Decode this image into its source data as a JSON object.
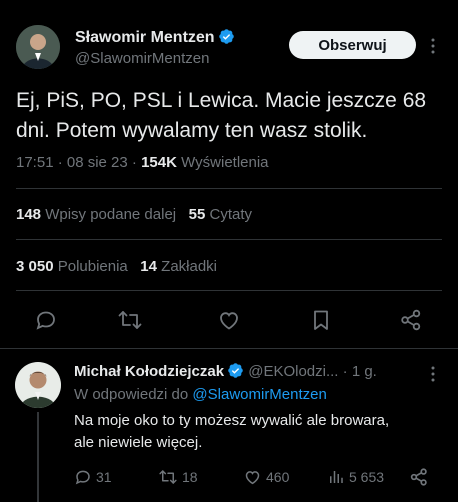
{
  "tweet": {
    "author_name": "Sławomir Mentzen",
    "author_handle": "@SlawomirMentzen",
    "follow_label": "Obserwuj",
    "text_line1": "Ej, PiS, PO, PSL i Lewica. Macie jeszcze 68",
    "text_line2": "dni. Potem wywalamy ten wasz stolik.",
    "time": "17:51 · 08 sie 23 ·",
    "views_count": "154K",
    "views_label": "Wyświetlenia",
    "reposts_count": "148",
    "reposts_label": "Wpisy podane dalej",
    "quotes_count": "55",
    "quotes_label": "Cytaty",
    "likes_count": "3 050",
    "likes_label": "Polubienia",
    "bookmarks_count": "14",
    "bookmarks_label": "Zakładki"
  },
  "reply": {
    "author_name": "Michał Kołodziejczak",
    "author_handle": "@EKOlodzi...",
    "time": "· 1 g.",
    "replying_prefix": "W odpowiedzi do",
    "replying_to": "@SlawomirMentzen",
    "text_line1": "Na moje oko to ty możesz wywalić ale browara,",
    "text_line2": "ale niewiele więcej.",
    "replies": "31",
    "reposts": "18",
    "likes": "460",
    "views": "5 653"
  },
  "colors": {
    "background": "#000000",
    "text": "#e7e9ea",
    "muted": "#71767b",
    "accent": "#1d9bf0",
    "verified": "#1d9bf0"
  },
  "icons": {
    "actions": [
      "reply-icon",
      "repost-icon",
      "like-icon",
      "bookmark-icon",
      "share-icon"
    ],
    "verified": "verified-badge-icon",
    "more": "more-vertical-icon"
  }
}
